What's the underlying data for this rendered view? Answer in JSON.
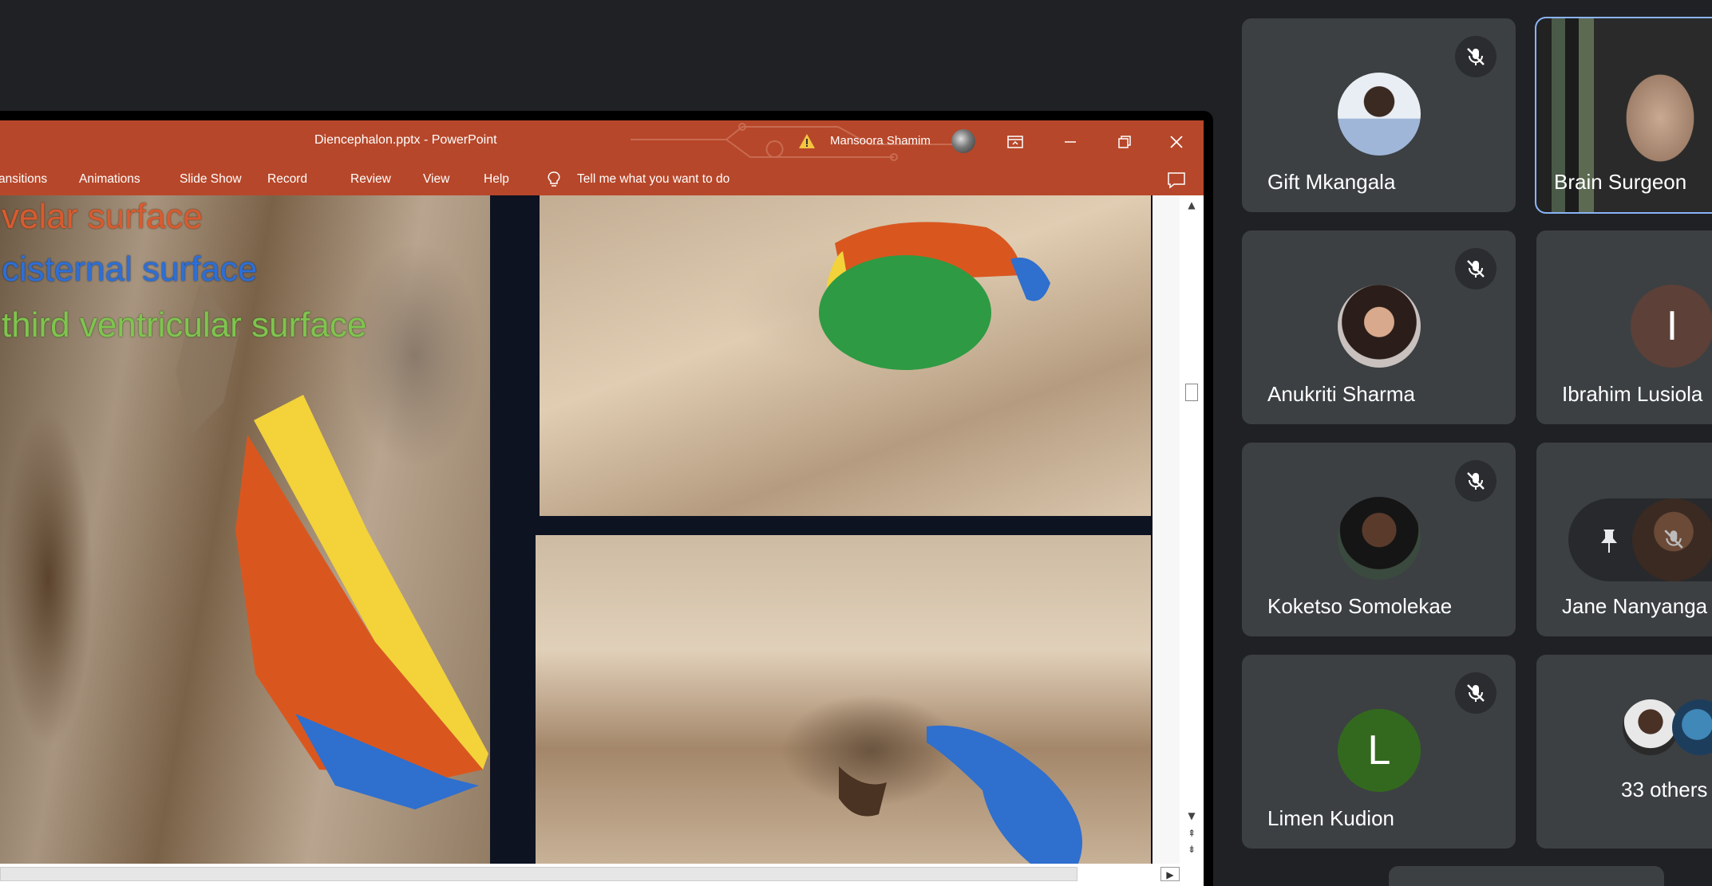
{
  "powerpoint": {
    "window_title": "Diencephalon.pptx  -  PowerPoint",
    "user_name": "Mansoora Shamim",
    "ribbon_tabs": [
      "ansitions",
      "Animations",
      "Slide Show",
      "Record",
      "Review",
      "View",
      "Help"
    ],
    "tell_me": "Tell me what you want to do",
    "slide_labels": {
      "velar": "velar surface",
      "cisternal": "cisternal surface",
      "third": "third ventricular surface"
    }
  },
  "participants": [
    {
      "name": "Gift Mkangala",
      "muted": true
    },
    {
      "name": "Brain Surgeon",
      "speaking": true
    },
    {
      "name": "Anukriti Sharma",
      "muted": true
    },
    {
      "name": "Ibrahim Lusiola",
      "initial": "I"
    },
    {
      "name": "Koketso Somolekae",
      "muted": true
    },
    {
      "name": "Jane Nanyanga"
    },
    {
      "name": "Limen Kudion",
      "initial": "L",
      "muted": true
    },
    {
      "name": "33 others"
    }
  ],
  "colors": {
    "ppt_accent": "#b7472a",
    "meet_bg": "#202124",
    "tile_bg": "#3c4043",
    "speaking_outline": "#8ab4f8"
  }
}
